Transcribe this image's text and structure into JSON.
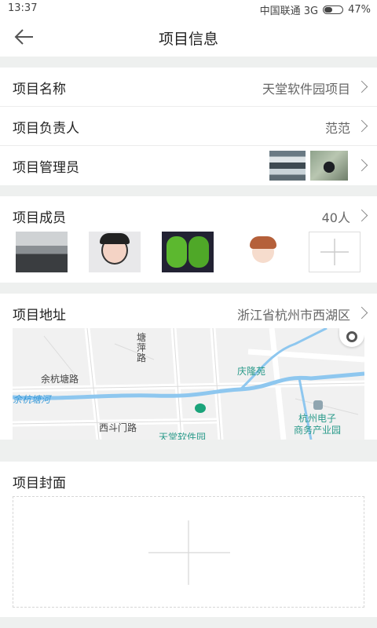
{
  "status_bar": {
    "time": "13:37",
    "carrier": "中国联通 3G",
    "battery": "47%",
    "battery_level": 0.47
  },
  "header": {
    "title": "项目信息"
  },
  "rows": {
    "name": {
      "label": "项目名称",
      "value": "天堂软件园项目"
    },
    "owner": {
      "label": "项目负责人",
      "value": "范范"
    },
    "admin": {
      "label": "项目管理员"
    },
    "members": {
      "label": "项目成员",
      "value": "40人"
    },
    "address": {
      "label": "项目地址",
      "value": "浙江省杭州市西湖区"
    },
    "cover": {
      "label": "项目封面"
    }
  },
  "map": {
    "labels": {
      "road1": "余杭塘路",
      "road2_line1": "塘",
      "road2_line2": "萍",
      "road2_line3": "路",
      "river": "余杭塘河",
      "park": "庆隆苑",
      "road3": "西斗门路",
      "poi": "天堂软件园",
      "center_line1": "杭州电子",
      "center_line2": "商务产业园"
    }
  },
  "icons": {
    "back": "arrow-left-icon",
    "chevron": "chevron-right-icon",
    "add": "plus-icon",
    "locate": "locate-icon",
    "building": "building-icon"
  },
  "colors": {
    "accent_marker": "#1aa37a",
    "river": "#8ec7ef"
  }
}
